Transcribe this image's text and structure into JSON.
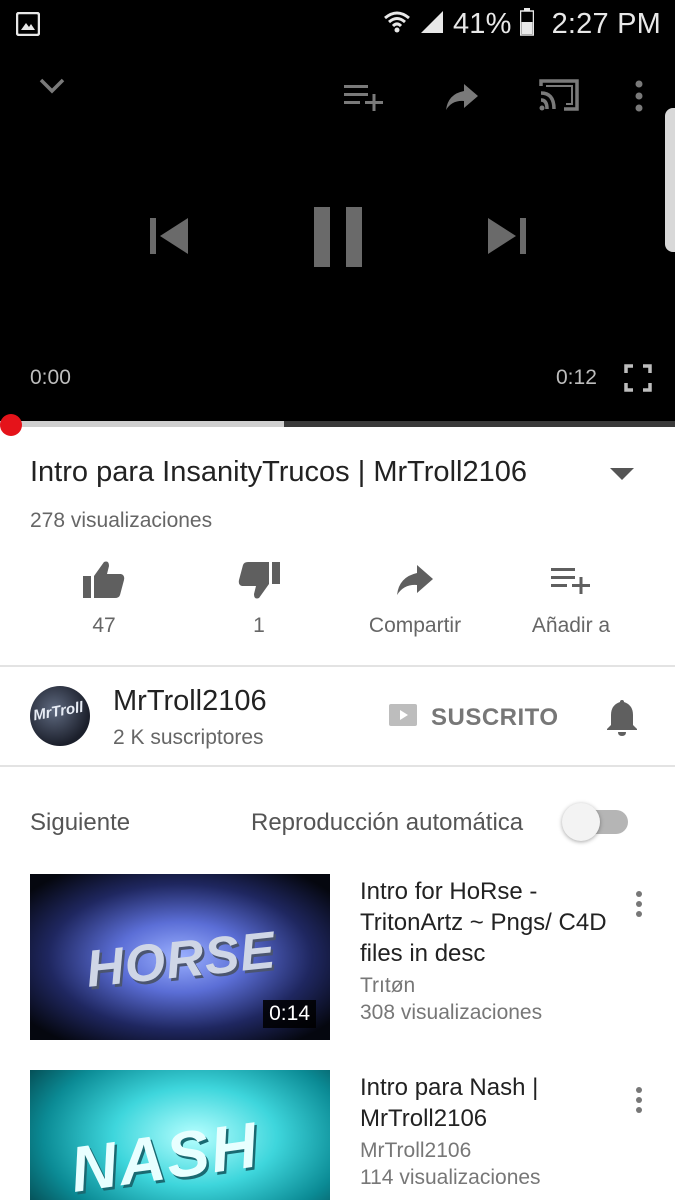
{
  "status_bar": {
    "battery": "41%",
    "time": "2:27 PM",
    "icons": [
      "gallery-icon",
      "wifi-icon",
      "signal-icon",
      "battery-icon"
    ]
  },
  "player": {
    "current_time": "0:00",
    "duration": "0:12",
    "progress": 0.0,
    "buffered": 0.42,
    "state": "playing",
    "icons": [
      "chevron-down-icon",
      "add-to-queue-icon",
      "share-icon",
      "cast-icon",
      "more-vert-icon",
      "previous-icon",
      "pause-icon",
      "next-icon",
      "fullscreen-icon"
    ]
  },
  "video": {
    "title": "Intro para InsanityTrucos | MrTroll2106",
    "views": "278 visualizaciones"
  },
  "actions": {
    "like_count": "47",
    "dislike_count": "1",
    "share_label": "Compartir",
    "add_label": "Añadir a"
  },
  "channel": {
    "name": "MrTroll2106",
    "subscribers": "2 K suscriptores",
    "avatar_text": "MrTroll",
    "subscribe_label": "SUSCRITO"
  },
  "up_next": {
    "label": "Siguiente",
    "autoplay_label": "Reproducción automática",
    "autoplay_on": false
  },
  "videos": [
    {
      "title": "Intro for HoRse - TritonArtz ~ Pngs/ C4D files in desc",
      "channel": "Trıtøn",
      "views": "308 visualizaciones",
      "duration": "0:14",
      "thumb_text": "HORSE"
    },
    {
      "title": "Intro para Nash | MrTroll2106",
      "channel": "MrTroll2106",
      "views": "114 visualizaciones",
      "thumb_text": "NASH"
    }
  ],
  "colors": {
    "accent_red": "#e5131a",
    "player_bg": "#000000",
    "text_primary": "#222222",
    "text_secondary": "#666666"
  }
}
